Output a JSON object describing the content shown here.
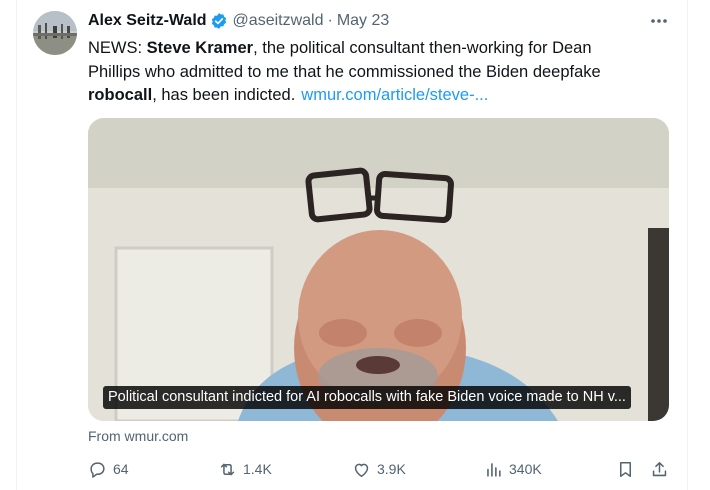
{
  "tweet": {
    "author_name": "Alex Seitz-Wald",
    "handle": "@aseitzwald",
    "separator": "·",
    "date": "May 23",
    "text": {
      "l1_prefix": "NEWS: ",
      "l1_bold": "Steve Kramer",
      "l1_rest": ", the political consultant then-working for Dean",
      "l2": "Phillips who admitted to me that he commissioned the Biden deepfake",
      "l3_bold": "robocall",
      "l3_rest": ", has been indicted.",
      "link": "wmur.com/article/steve-..."
    },
    "media": {
      "caption": "Political consultant indicted for AI robocalls with fake Biden voice made to NH v..."
    },
    "source": "From wmur.com",
    "actions": {
      "replies": "64",
      "reposts": "1.4K",
      "likes": "3.9K",
      "views": "340K"
    },
    "colors": {
      "verified": "#1d9bf0",
      "link": "#1d9bf0",
      "secondary_text": "#536471"
    },
    "icons": [
      "verified-badge-icon",
      "more-icon",
      "reply-icon",
      "repost-icon",
      "like-icon",
      "views-icon",
      "bookmark-icon",
      "share-icon"
    ]
  }
}
